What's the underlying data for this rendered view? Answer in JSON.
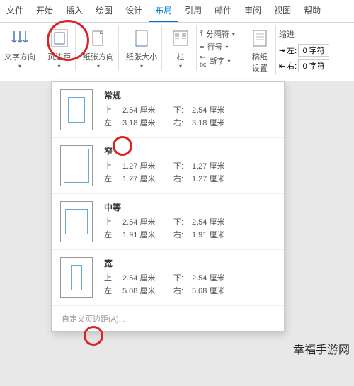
{
  "menubar": [
    "文件",
    "开始",
    "插入",
    "绘图",
    "设计",
    "布局",
    "引用",
    "邮件",
    "审阅",
    "视图",
    "帮助"
  ],
  "active_menu_index": 5,
  "ribbon": {
    "text_direction": "文字方向",
    "margins": "页边距",
    "orientation": "纸张方向",
    "size": "纸张大小",
    "columns": "栏",
    "breaks": "分隔符",
    "line_numbers": "行号",
    "hyphenation": "断字",
    "manuscript": "稿纸\n设置",
    "indent_label": "缩进",
    "indent_left_label": "左:",
    "indent_left_value": "0 字符",
    "indent_right_label": "右:",
    "indent_right_value": "0 字符"
  },
  "margin_presets": [
    {
      "name": "常规",
      "thumb": "thumb-normal",
      "top_l": "上:",
      "top_v": "2.54 厘米",
      "bot_l": "下:",
      "bot_v": "2.54 厘米",
      "left_l": "左:",
      "left_v": "3.18 厘米",
      "right_l": "右:",
      "right_v": "3.18 厘米"
    },
    {
      "name": "窄",
      "thumb": "thumb-narrow",
      "top_l": "上:",
      "top_v": "1.27 厘米",
      "bot_l": "下:",
      "bot_v": "1.27 厘米",
      "left_l": "左:",
      "left_v": "1.27 厘米",
      "right_l": "右:",
      "right_v": "1.27 厘米"
    },
    {
      "name": "中等",
      "thumb": "thumb-medium",
      "top_l": "上:",
      "top_v": "2.54 厘米",
      "bot_l": "下:",
      "bot_v": "2.54 厘米",
      "left_l": "左:",
      "left_v": "1.91 厘米",
      "right_l": "右:",
      "right_v": "1.91 厘米"
    },
    {
      "name": "宽",
      "thumb": "thumb-wide",
      "top_l": "上:",
      "top_v": "2.54 厘米",
      "bot_l": "下:",
      "bot_v": "2.54 厘米",
      "left_l": "左:",
      "left_v": "5.08 厘米",
      "right_l": "右:",
      "right_v": "5.08 厘米"
    }
  ],
  "custom_margins": "自定义页边距(A)...",
  "watermark": "幸福手游网"
}
